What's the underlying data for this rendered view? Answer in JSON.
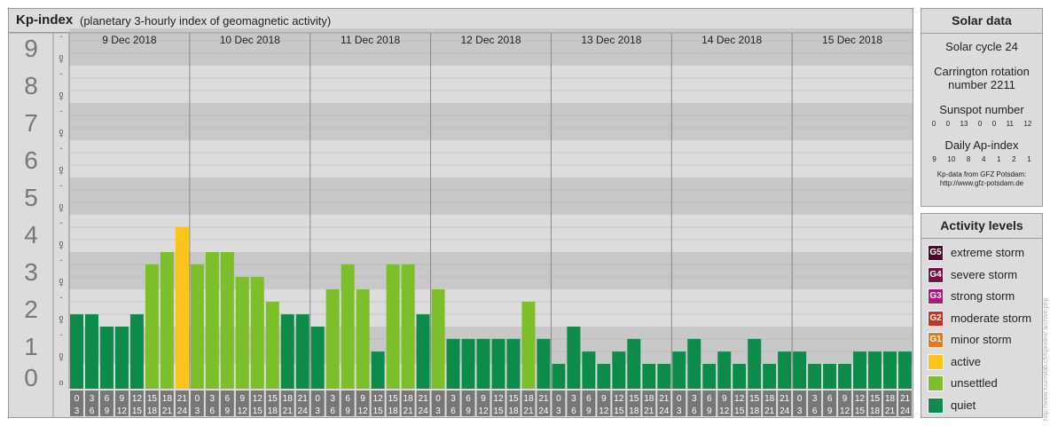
{
  "header": {
    "title": "Kp-index",
    "subtitle": "(planetary 3-hourly index of geomagnetic activity)"
  },
  "chart_data": {
    "type": "bar",
    "title": "Kp-index",
    "subtitle": "(planetary 3-hourly index of geomagnetic activity)",
    "days": [
      "9 Dec 2018",
      "10 Dec 2018",
      "11 Dec 2018",
      "12 Dec 2018",
      "13 Dec 2018",
      "14 Dec 2018",
      "15 Dec 2018"
    ],
    "interval_start_labels": [
      "0",
      "3",
      "6",
      "9",
      "12",
      "15",
      "18",
      "21"
    ],
    "interval_end_labels": [
      "3",
      "6",
      "9",
      "12",
      "15",
      "18",
      "21",
      "24"
    ],
    "y_levels": [
      "0",
      "1",
      "2",
      "3",
      "4",
      "5",
      "6",
      "7",
      "8",
      "9"
    ],
    "y_sublabels": [
      "o",
      "+",
      "-"
    ],
    "ylim": [
      0,
      9
    ],
    "values": [
      [
        1.33,
        1.33,
        1.0,
        1.0,
        1.33,
        2.67,
        3.0,
        3.67
      ],
      [
        2.67,
        3.0,
        3.0,
        2.33,
        2.33,
        1.67,
        1.33,
        1.33
      ],
      [
        1.0,
        2.0,
        2.67,
        2.0,
        0.33,
        2.67,
        2.67,
        1.33
      ],
      [
        2.0,
        0.67,
        0.67,
        0.67,
        0.67,
        0.67,
        1.67,
        0.67
      ],
      [
        0.0,
        1.0,
        0.33,
        0.0,
        0.33,
        0.67,
        0.0,
        0.0
      ],
      [
        0.33,
        0.67,
        0.0,
        0.33,
        0.0,
        0.67,
        0.0,
        0.33
      ],
      [
        0.33,
        0.0,
        0.0,
        0.0,
        0.33,
        0.33,
        0.33,
        0.33
      ]
    ]
  },
  "solar": {
    "title": "Solar data",
    "cycle": "Solar cycle 24",
    "carrington_line1": "Carrington rotation",
    "carrington_line2": "number 2211",
    "sunspot_label": "Sunspot number",
    "sunspot_values": [
      "0",
      "0",
      "13",
      "0",
      "0",
      "11",
      "12"
    ],
    "ap_label": "Daily Ap-index",
    "ap_values": [
      "9",
      "10",
      "8",
      "4",
      "1",
      "2",
      "1"
    ],
    "credit_line1": "Kp-data from GFZ Potsdam:",
    "credit_line2": "http://www.gfz-potsdam.de"
  },
  "levels": {
    "title": "Activity levels",
    "items": [
      {
        "code": "G5",
        "label": "extreme storm",
        "color": "#4a0a2a"
      },
      {
        "code": "G4",
        "label": "severe storm",
        "color": "#7a1048"
      },
      {
        "code": "G3",
        "label": "strong storm",
        "color": "#b5147e"
      },
      {
        "code": "G2",
        "label": "moderate storm",
        "color": "#cf2f1f"
      },
      {
        "code": "G1",
        "label": "minor storm",
        "color": "#e8781a"
      },
      {
        "code": "",
        "label": "active",
        "color": "#fcc419"
      },
      {
        "code": "",
        "label": "unsettled",
        "color": "#7cbf2a"
      },
      {
        "code": "",
        "label": "quiet",
        "color": "#0c8b4a"
      }
    ]
  },
  "colors": {
    "quiet": "#0c8b4a",
    "unsettled": "#7cbf2a",
    "active": "#fcc419",
    "band_dark": "#c8c8c8",
    "band_light": "#dcdcdc"
  },
  "watermark": "http://www.fourmilab.ch/kpindex/ archive.php"
}
